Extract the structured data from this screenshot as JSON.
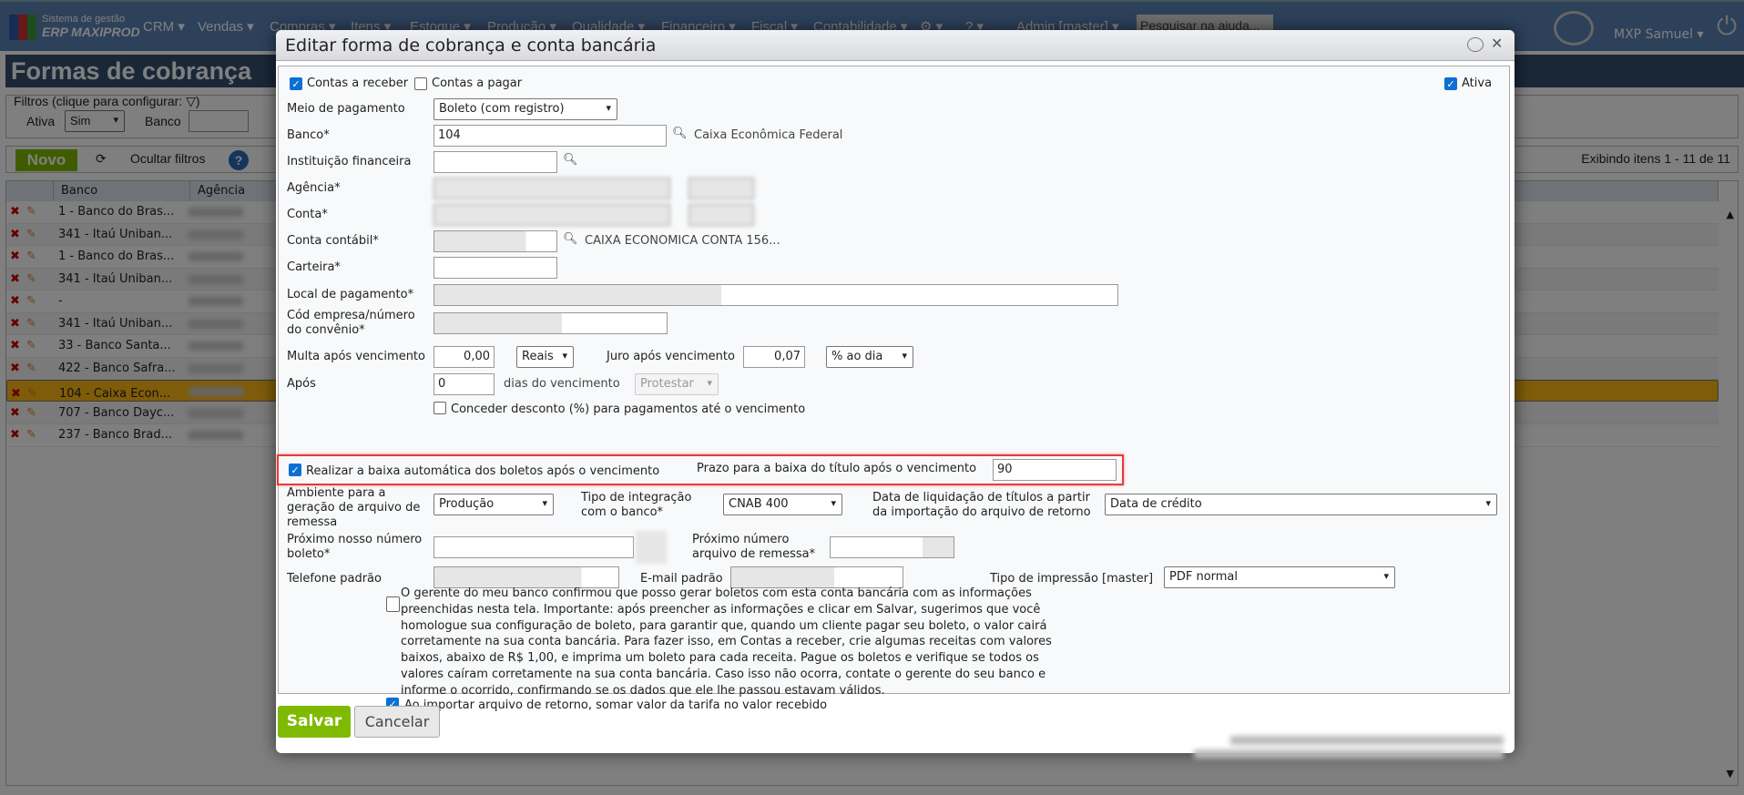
{
  "nav": {
    "logo_line1": "Sistema de gestão",
    "logo_line2": "ERP MAXIPROD",
    "menus": [
      "CRM",
      "Vendas",
      "Compras",
      "Itens",
      "Estoque",
      "Produção",
      "Qualidade",
      "Financeiro",
      "Fiscal",
      "Contabilidade",
      "Admin [master]"
    ],
    "help_placeholder": "Pesquisar na ajuda...",
    "user": "MXP Samuel"
  },
  "page": {
    "title": "Formas de cobrança",
    "filters_legend": "Filtros (clique para configurar:",
    "filter_ativa_label": "Ativa",
    "filter_ativa_value": "Sim",
    "filter_banco_label": "Banco",
    "novo": "Novo",
    "ocultar_filtros": "Ocultar filtros",
    "paging": "Exibindo itens 1 - 11 de 11",
    "columns": [
      "Banco",
      "Agência"
    ],
    "rows": [
      "1 - Banco do Bras...",
      "341 - Itaú Uniban...",
      "1 - Banco do Bras...",
      "341 - Itaú Uniban...",
      "-",
      "341 - Itaú Uniban...",
      "33 - Banco Santa...",
      "422 - Banco Safra...",
      "104 - Caixa Econ...",
      "707 - Banco Dayc...",
      "237 - Banco Brad..."
    ],
    "selected_row": 8
  },
  "dialog": {
    "title": "Editar forma de cobrança e conta bancária",
    "contas_receber": "Contas a receber",
    "contas_receber_checked": true,
    "contas_pagar": "Contas a pagar",
    "contas_pagar_checked": false,
    "ativa": "Ativa",
    "ativa_checked": true,
    "meio_label": "Meio de pagamento",
    "meio_value": "Boleto (com registro)",
    "banco_label": "Banco*",
    "banco_value": "104",
    "banco_name": "Caixa Econômica Federal",
    "instituicao_label": "Instituição financeira",
    "agencia_label": "Agência*",
    "conta_label": "Conta*",
    "conta_contabil_label": "Conta contábil*",
    "conta_contabil_name": "CAIXA ECONOMICA CONTA 156...",
    "carteira_label": "Carteira*",
    "local_label": "Local de pagamento*",
    "cod_label_1": "Cód empresa/número",
    "cod_label_2": "do convênio*",
    "multa_label": "Multa após vencimento",
    "multa_value": "0,00",
    "multa_unit": "Reais",
    "juro_label": "Juro após vencimento",
    "juro_value": "0,07",
    "juro_unit": "% ao dia",
    "apos_label": "Após",
    "apos_value": "0",
    "dias_label": "dias do vencimento",
    "protestar": "Protestar",
    "desconto": "Conceder desconto (%) para pagamentos até o vencimento",
    "desconto_checked": false,
    "baixa_auto": "Realizar a baixa automática dos boletos após o vencimento",
    "baixa_auto_checked": true,
    "prazo_label": "Prazo para a baixa do título após o vencimento",
    "prazo_value": "90",
    "ambiente_l1": "Ambiente para a",
    "ambiente_l2": "geração de arquivo de",
    "ambiente_l3": "remessa",
    "ambiente_value": "Produção",
    "integracao_l1": "Tipo de integração",
    "integracao_l2": "com o banco*",
    "integracao_value": "CNAB 400",
    "liquidacao_l1": "Data de liquidação de títulos a partir",
    "liquidacao_l2": "da importação do arquivo de retorno",
    "liquidacao_value": "Data de crédito",
    "nosso_l1": "Próximo nosso número",
    "nosso_l2": "boleto*",
    "remessa_l1": "Próximo número",
    "remessa_l2": "arquivo de remessa*",
    "telefone_label": "Telefone padrão",
    "email_label": "E-mail padrão",
    "impressao_label": "Tipo de impressão [master]",
    "impressao_value": "PDF normal",
    "gerente_text": "O gerente do meu banco confirmou que posso gerar boletos com esta conta bancária com as informações preenchidas nesta tela. Importante: após preencher as informações e clicar em Salvar, sugerimos que você homologue sua configuração de boleto, para garantir que, quando um cliente pagar seu boleto, o valor cairá corretamente na sua conta bancária. Para fazer isso, em Contas a receber, crie algumas receitas com valores baixos, abaixo de R$ 1,00, e imprima um boleto para cada receita. Pague os boletos e verifique se todos os valores caíram corretamente na sua conta bancária. Caso isso não ocorra, contate o gerente do seu banco e informe o ocorrido, confirmando se os dados que ele lhe passou estavam válidos.",
    "gerente_checked": false,
    "tarifa": "Ao importar arquivo de retorno, somar valor da tarifa no valor recebido",
    "tarifa_checked": true,
    "salvar": "Salvar",
    "cancelar": "Cancelar"
  }
}
